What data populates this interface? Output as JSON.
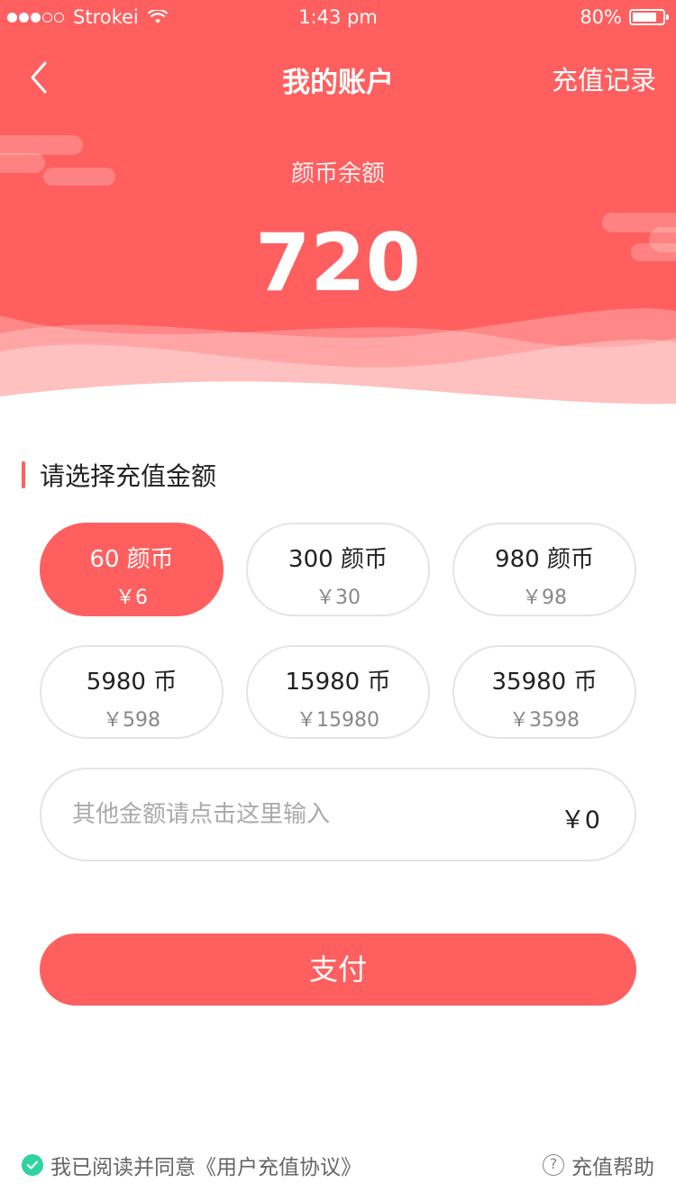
{
  "status_bar": {
    "carrier": "Strokei",
    "signal": {
      "filled": 3,
      "total": 5
    },
    "time": "1:43 pm",
    "battery_text": "80%",
    "battery_level": 0.8
  },
  "nav": {
    "title": "我的账户",
    "right_action": "充值记录"
  },
  "balance": {
    "label": "颜币余额",
    "value": "720"
  },
  "section": {
    "title": "请选择充值金额"
  },
  "options": [
    {
      "coins": "60 颜币",
      "price": "￥6",
      "selected": true
    },
    {
      "coins": "300 颜币",
      "price": "￥30",
      "selected": false
    },
    {
      "coins": "980 颜币",
      "price": "￥98",
      "selected": false
    },
    {
      "coins": "5980 币",
      "price": "￥598",
      "selected": false
    },
    {
      "coins": "15980 币",
      "price": "￥15980",
      "selected": false
    },
    {
      "coins": "35980 币",
      "price": "￥3598",
      "selected": false
    }
  ],
  "custom": {
    "placeholder": "其他金额请点击这里输入",
    "amount": "￥0"
  },
  "pay_button": "支付",
  "footer": {
    "agree_text": "我已阅读并同意《用户充值协议》",
    "help_text": "充值帮助",
    "help_icon_glyph": "?"
  },
  "colors": {
    "accent": "#ff5f5f",
    "check": "#2fd3a2"
  }
}
